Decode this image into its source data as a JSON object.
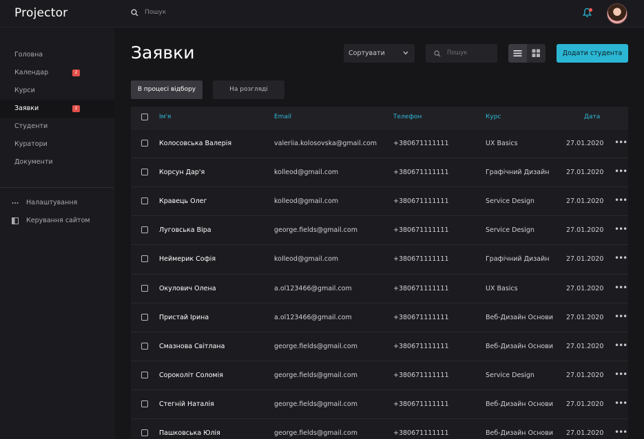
{
  "app": {
    "logo": "Projector"
  },
  "topbar": {
    "search_placeholder": "Пошук"
  },
  "sidebar": {
    "items": [
      {
        "label": "Головна",
        "badge": null
      },
      {
        "label": "Календар",
        "badge": "2"
      },
      {
        "label": "Курси",
        "badge": null
      },
      {
        "label": "Заявки",
        "badge": "2"
      },
      {
        "label": "Студенти",
        "badge": null
      },
      {
        "label": "Куратори",
        "badge": null
      },
      {
        "label": "Документи",
        "badge": null
      }
    ],
    "extra": [
      {
        "label": "Налаштування",
        "icon": "dots-icon"
      },
      {
        "label": "Керування сайтом",
        "icon": "site-icon"
      }
    ]
  },
  "main": {
    "title": "Заявки",
    "sort_label": "Сортувати",
    "search_placeholder": "Пошук",
    "add_button": "Додати студента",
    "tabs": [
      {
        "label": "В процесі відбору",
        "active": true
      },
      {
        "label": "На розгляді",
        "active": false
      }
    ]
  },
  "table": {
    "headers": {
      "name": "Ім'я",
      "email": "Email",
      "phone": "Телефон",
      "course": "Курс",
      "date": "Дата"
    },
    "rows": [
      {
        "name": "Колосовська Валерія",
        "email": "valeriia.kolosovska@gmail.com",
        "phone": "+380671111111",
        "course": "UX Basics",
        "date": "27.01.2020"
      },
      {
        "name": "Корсун Дар'я",
        "email": "kolleod@gmail.com",
        "phone": "+380671111111",
        "course": "Графічний Дизайн",
        "date": "27.01.2020"
      },
      {
        "name": "Кравець Олег",
        "email": "kolleod@gmail.com",
        "phone": "+380671111111",
        "course": "Service Design",
        "date": "27.01.2020"
      },
      {
        "name": "Луговська Віра",
        "email": "george.fields@gmail.com",
        "phone": "+380671111111",
        "course": "Service Design",
        "date": "27.01.2020"
      },
      {
        "name": "Неймерик Софія",
        "email": "kolleod@gmail.com",
        "phone": "+380671111111",
        "course": "Графічний Дизайн",
        "date": "27.01.2020"
      },
      {
        "name": "Окулович Олена",
        "email": "a.ol123466@gmail.com",
        "phone": "+380671111111",
        "course": "UX Basics",
        "date": "27.01.2020"
      },
      {
        "name": "Пристай Ірина",
        "email": "a.ol123466@gmail.com",
        "phone": "+380671111111",
        "course": "Веб-Дизайн Основи",
        "date": "27.01.2020"
      },
      {
        "name": "Смазнова Світлана",
        "email": "george.fields@gmail.com",
        "phone": "+380671111111",
        "course": "Веб-Дизайн Основи",
        "date": "27.01.2020"
      },
      {
        "name": "Сороколіт Соломія",
        "email": "george.fields@gmail.com",
        "phone": "+380671111111",
        "course": "Service Design",
        "date": "27.01.2020"
      },
      {
        "name": "Стегній Наталія",
        "email": "george.fields@gmail.com",
        "phone": "+380671111111",
        "course": "Веб-Дизайн Основи",
        "date": "27.01.2020"
      },
      {
        "name": "Пашковська Юлія",
        "email": "george.fields@gmail.com",
        "phone": "+380671111111",
        "course": "Веб-Дизайн Основи",
        "date": "27.01.2020"
      }
    ]
  },
  "colors": {
    "accent": "#2bb7d4",
    "badge": "#e2504a",
    "background": "#161619",
    "panel": "#1b1b1f"
  }
}
